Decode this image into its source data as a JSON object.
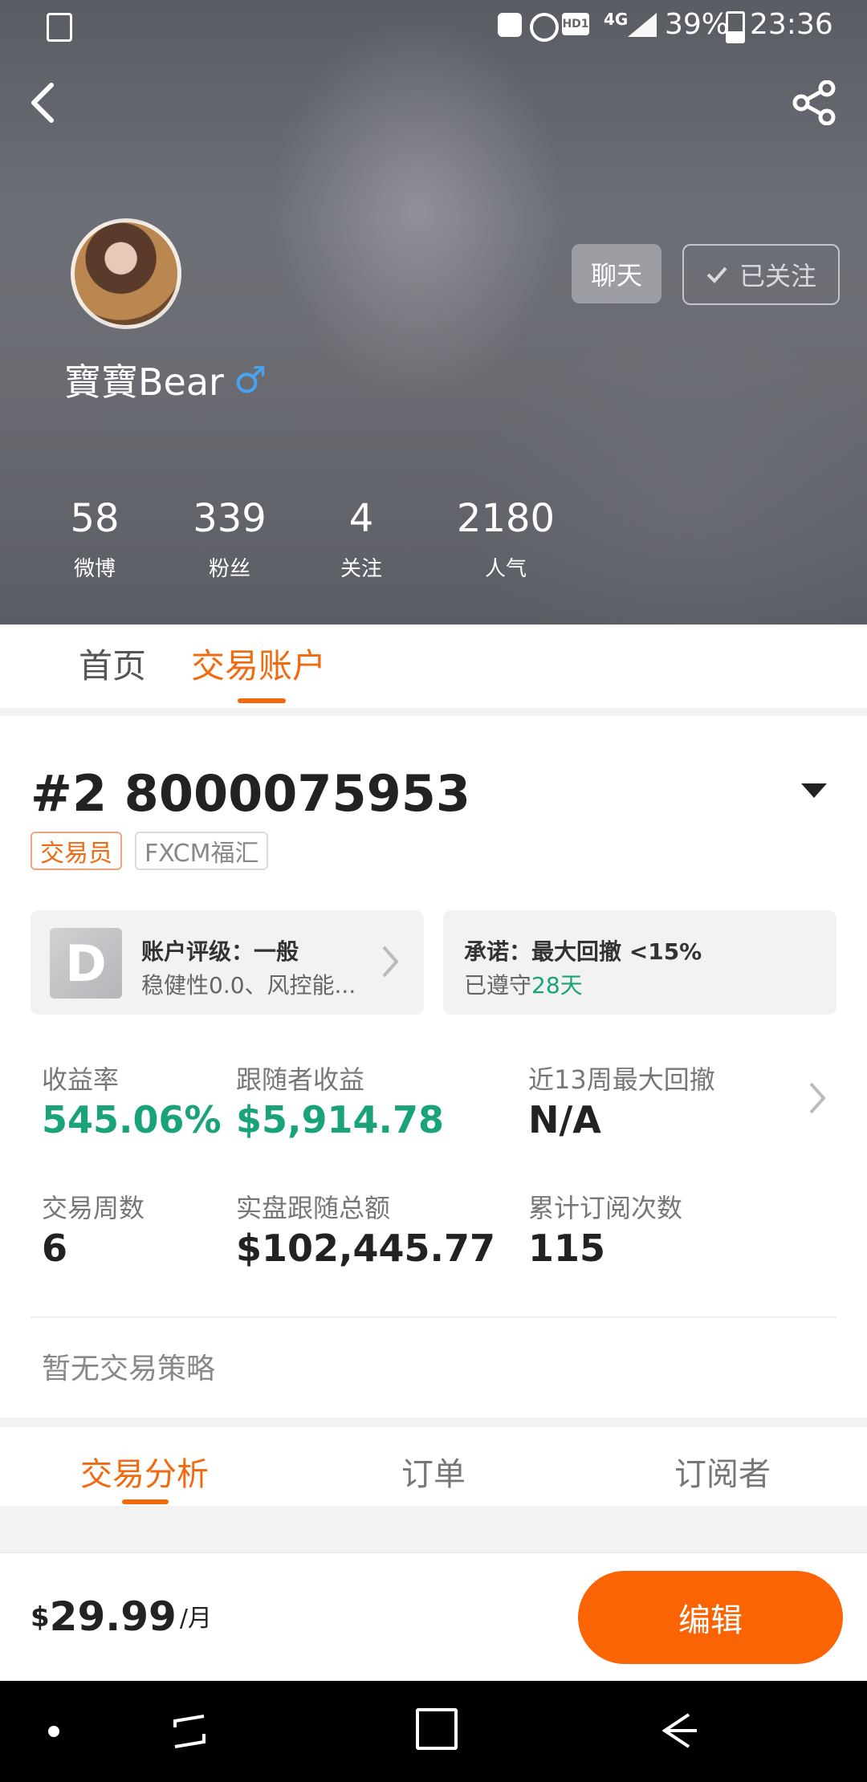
{
  "status_bar": {
    "battery": "39%",
    "time": "23:36",
    "network": "4G",
    "hd": "HD1"
  },
  "header": {
    "back_icon": "back-arrow-icon",
    "share_icon": "share-icon"
  },
  "profile": {
    "name": "寶寶Bear",
    "gender_symbol": "♂",
    "chat_label": "聊天",
    "follow_label": "已关注",
    "stats": [
      {
        "value": "58",
        "label": "微博"
      },
      {
        "value": "339",
        "label": "粉丝"
      },
      {
        "value": "4",
        "label": "关注"
      },
      {
        "value": "2180",
        "label": "人气"
      }
    ]
  },
  "tabs_top": [
    {
      "label": "首页"
    },
    {
      "label": "交易账户"
    }
  ],
  "account": {
    "title": "#2 8000075953",
    "tags": [
      "交易员",
      "FXCM福汇"
    ],
    "rating_badge": "D",
    "rating_title": "账户评级：一般",
    "rating_sub": "稳健性0.0、风控能...",
    "promise_title": "承诺：最大回撤 <15%",
    "promise_prefix": "已遵守",
    "promise_days": "28天",
    "metrics": [
      {
        "label": "收益率",
        "value": "545.06%"
      },
      {
        "label": "跟随者收益",
        "value": "$5,914.78"
      },
      {
        "label": "近13周最大回撤",
        "value": "N/A"
      },
      {
        "label": "交易周数",
        "value": "6"
      },
      {
        "label": "实盘跟随总额",
        "value": "$102,445.77"
      },
      {
        "label": "累计订阅次数",
        "value": "115"
      }
    ],
    "no_strategy": "暂无交易策略"
  },
  "tabs_bottom": [
    {
      "label": "交易分析"
    },
    {
      "label": "订单"
    },
    {
      "label": "订阅者"
    }
  ],
  "subscription": {
    "currency": "$",
    "amount": "29.99",
    "period": "/月",
    "edit_label": "编辑"
  },
  "colors": {
    "accent": "#fb6404",
    "green": "#1aa37a"
  }
}
